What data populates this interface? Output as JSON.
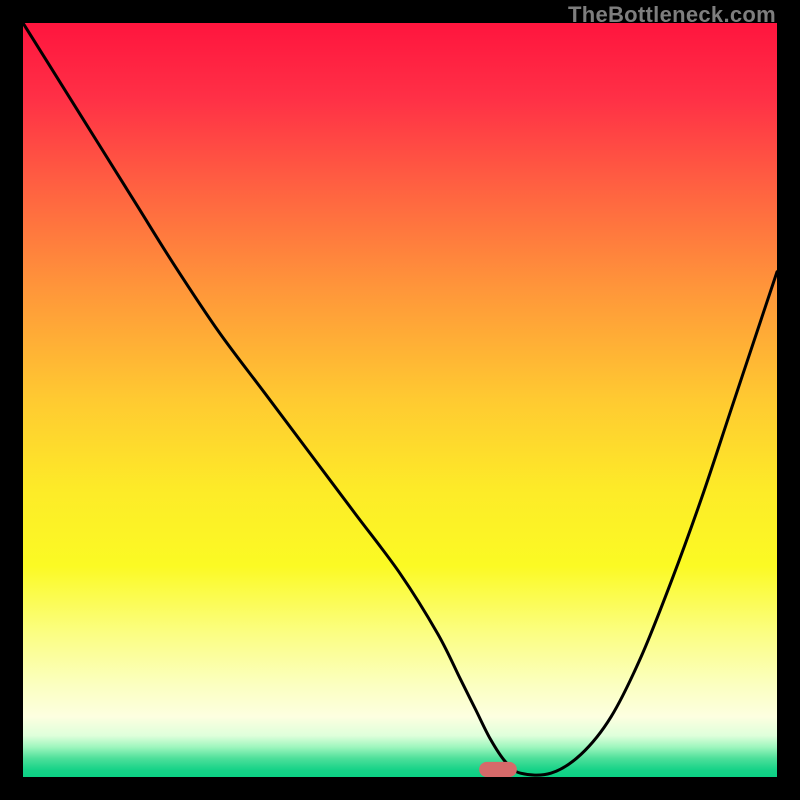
{
  "watermark": "TheBottleneck.com",
  "chart_data": {
    "type": "line",
    "title": "",
    "xlabel": "",
    "ylabel": "",
    "xlim": [
      0,
      100
    ],
    "ylim": [
      0,
      100
    ],
    "grid": false,
    "legend": false,
    "annotations": [],
    "background_gradient": {
      "stops": [
        {
          "offset": 0.0,
          "color": "#ff153e"
        },
        {
          "offset": 0.1,
          "color": "#ff3046"
        },
        {
          "offset": 0.22,
          "color": "#ff6241"
        },
        {
          "offset": 0.35,
          "color": "#ff953a"
        },
        {
          "offset": 0.5,
          "color": "#ffca31"
        },
        {
          "offset": 0.62,
          "color": "#fdeb28"
        },
        {
          "offset": 0.72,
          "color": "#fbfa24"
        },
        {
          "offset": 0.81,
          "color": "#fbfe83"
        },
        {
          "offset": 0.88,
          "color": "#fbffc2"
        },
        {
          "offset": 0.92,
          "color": "#fdffe0"
        },
        {
          "offset": 0.945,
          "color": "#dfffdb"
        },
        {
          "offset": 0.96,
          "color": "#9ff6be"
        },
        {
          "offset": 0.975,
          "color": "#4fe09b"
        },
        {
          "offset": 0.99,
          "color": "#18d388"
        },
        {
          "offset": 1.0,
          "color": "#0bd084"
        }
      ]
    },
    "series": [
      {
        "name": "bottleneck-curve",
        "color": "#000000",
        "x": [
          0,
          5,
          10,
          15,
          20,
          26,
          32,
          38,
          44,
          50,
          55,
          58,
          60,
          62,
          64,
          66,
          70,
          74,
          78,
          82,
          86,
          90,
          94,
          98,
          100
        ],
        "y": [
          100,
          92,
          84,
          76,
          68,
          59,
          51,
          43,
          35,
          27,
          19,
          13,
          9,
          5,
          2,
          0.5,
          0.5,
          3,
          8,
          16,
          26,
          37,
          49,
          61,
          67
        ]
      }
    ],
    "marker": {
      "name": "sweet-spot",
      "color": "#d66a6a",
      "shape": "pill",
      "x": 63,
      "y": 0,
      "width": 5,
      "height": 2
    }
  }
}
